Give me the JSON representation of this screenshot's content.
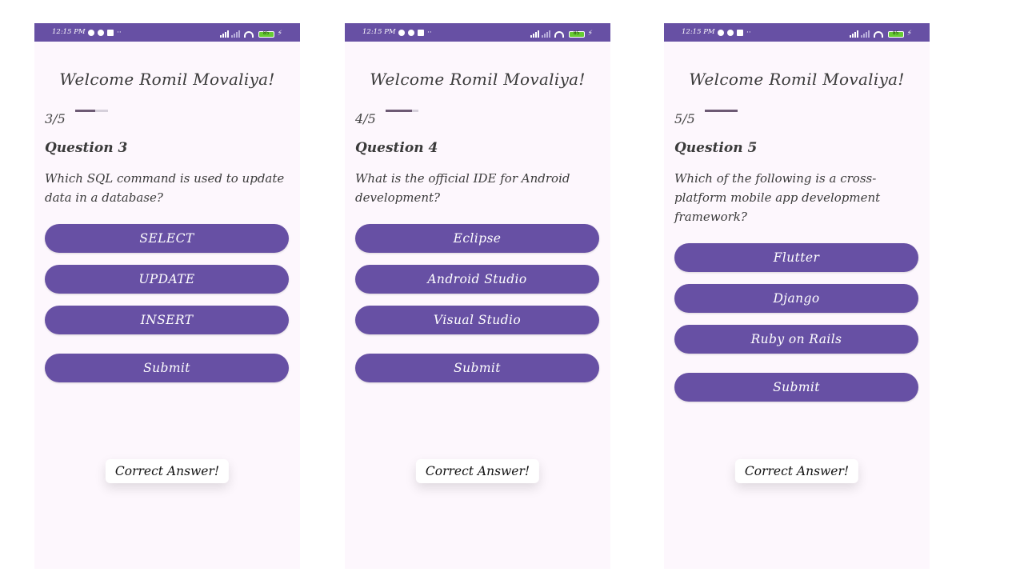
{
  "status": {
    "time": "12:15 PM",
    "battery": "85"
  },
  "screens": [
    {
      "welcome": "Welcome Romil Movaliya!",
      "progress_label": "3/5",
      "progress_fraction": 0.6,
      "question_title": "Question 3",
      "question_text": "Which SQL command is used to update data in a database?",
      "options": [
        "SELECT",
        "UPDATE",
        "INSERT"
      ],
      "submit_label": "Submit",
      "toast": "Correct Answer!"
    },
    {
      "welcome": "Welcome Romil Movaliya!",
      "progress_label": "4/5",
      "progress_fraction": 0.8,
      "question_title": "Question 4",
      "question_text": "What is the official IDE for Android development?",
      "options": [
        "Eclipse",
        "Android Studio",
        "Visual Studio"
      ],
      "submit_label": "Submit",
      "toast": "Correct Answer!"
    },
    {
      "welcome": "Welcome Romil Movaliya!",
      "progress_label": "5/5",
      "progress_fraction": 1.0,
      "question_title": "Question 5",
      "question_text": "Which of the following is a cross-platform mobile app development framework?",
      "options": [
        "Flutter",
        "Django",
        "Ruby on Rails"
      ],
      "submit_label": "Submit",
      "toast": "Correct Answer!"
    }
  ],
  "colors": {
    "accent": "#6750a4",
    "background": "#fdf7fd",
    "progress": "#6d5a74"
  }
}
